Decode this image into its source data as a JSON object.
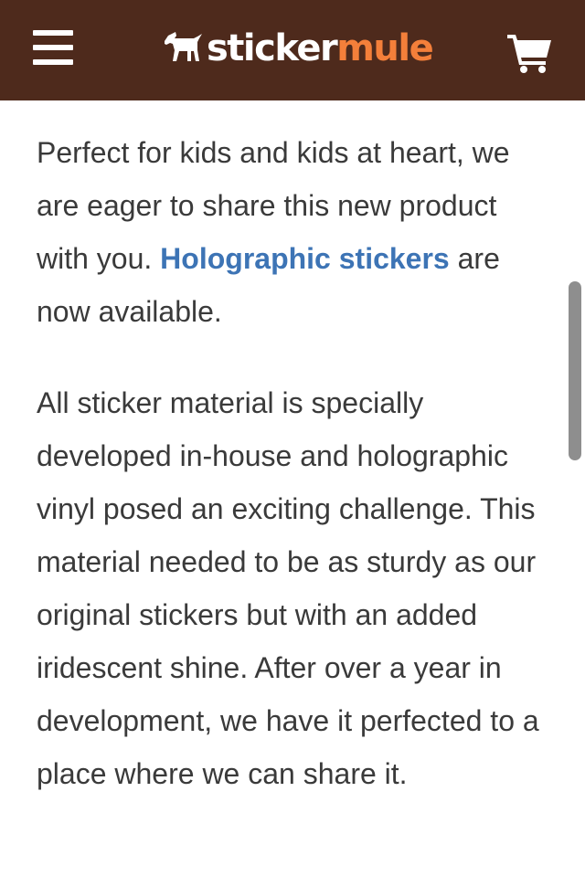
{
  "header": {
    "brand_part1": "sticker",
    "brand_part2": "mule",
    "menu_icon": "hamburger-menu-icon",
    "cart_icon": "shopping-cart-icon",
    "logo_icon": "mule-icon",
    "background_color": "#4e2a1c",
    "accent_color": "#f47f3a"
  },
  "article": {
    "p1_text_before_link": "Perfect for kids and kids at heart, we are eager to share this new product with you. ",
    "p1_link": "Holographic stickers",
    "p1_text_after_link": " are now available.",
    "p2_text": "All sticker material is specially developed in-house and holographic vinyl posed an exciting challenge. This material needed to be as sturdy as our original stickers but with an added iridescent shine. After over a year in development, we have it perfected to a place where we can share it.",
    "link_color": "#3d74b5"
  }
}
